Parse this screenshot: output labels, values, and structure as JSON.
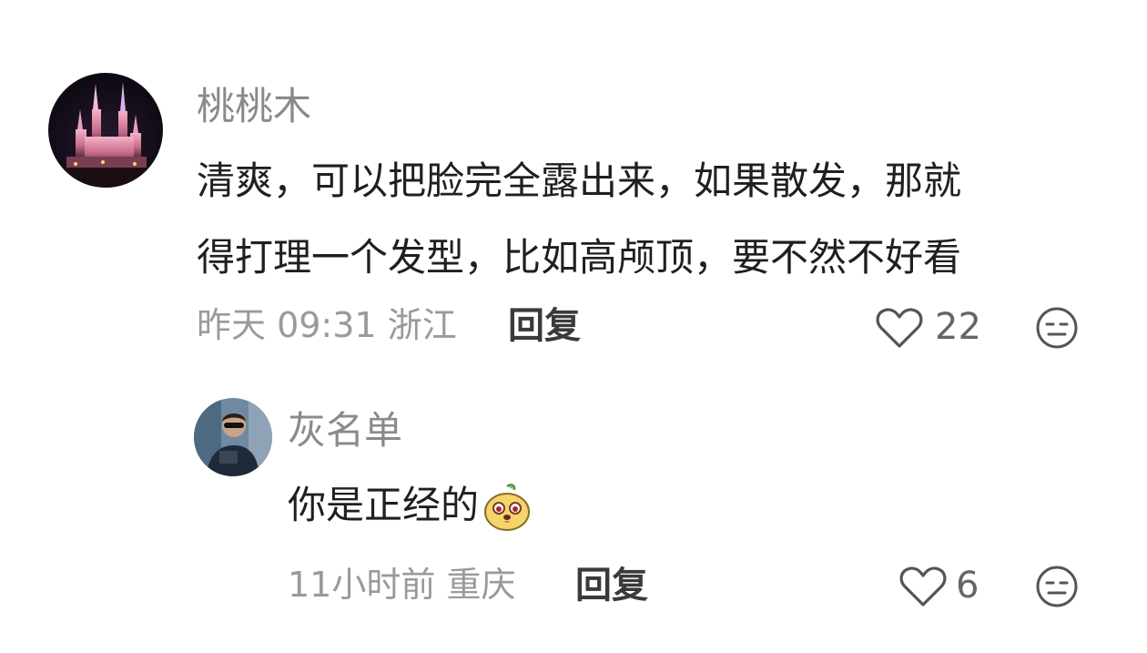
{
  "comments": [
    {
      "user": "桃桃木",
      "text_line1": "清爽，可以把脸完全露出来，如果散发，那就",
      "text_line2": "得打理一个发型，比如高颅顶，要不然不好看",
      "time": "昨天 09:31",
      "location": "浙江",
      "reply_label": "回复",
      "likes": "22",
      "avatar_icon": "castle-night-avatar"
    },
    {
      "user": "灰名单",
      "text": "你是正经的",
      "emoji_icon": "cute-dog-emoji-icon",
      "time": "11小时前",
      "location": "重庆",
      "reply_label": "回复",
      "likes": "6",
      "avatar_icon": "man-sunglasses-avatar"
    }
  ],
  "colors": {
    "name": "#8a8a8a",
    "meta": "#9a9a9a",
    "text": "#1f1f1f"
  }
}
